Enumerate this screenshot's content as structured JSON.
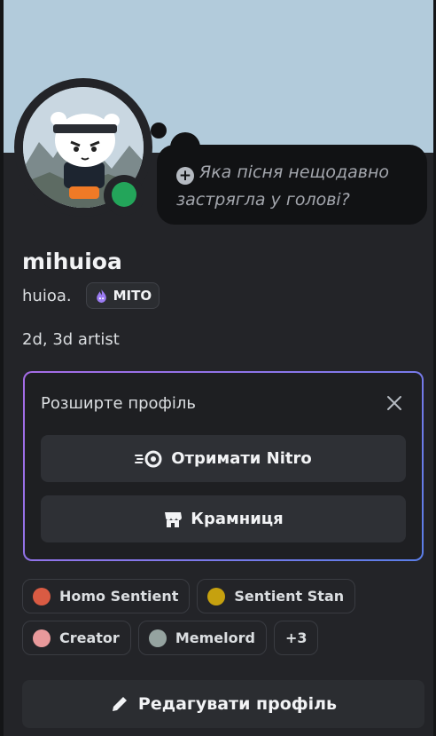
{
  "profile": {
    "display_name": "mihuioa",
    "username": "huioa.",
    "tag": "МІТО",
    "bio": "2d, 3d artist",
    "status_color": "#23a55a",
    "banner_color": "#b2cbdb"
  },
  "status_bubble": {
    "icon": "plus-circle-icon",
    "placeholder": "Яка пісня нещодавно застрягла у голові?"
  },
  "promo": {
    "title": "Розширте профіль",
    "close_icon": "close-icon",
    "nitro_label": "Отримати Nitro",
    "nitro_icon": "nitro-icon",
    "shop_label": "Крамниця",
    "shop_icon": "shop-icon"
  },
  "roles": [
    {
      "label": "Homo Sentient",
      "color": "#d95b43"
    },
    {
      "label": "Sentient Stan",
      "color": "#c6a10f"
    },
    {
      "label": "Creator",
      "color": "#e8999b"
    },
    {
      "label": "Memelord",
      "color": "#95a3a0"
    }
  ],
  "roles_more": "+3",
  "edit_button": {
    "label": "Редагувати профіль",
    "icon": "pencil-icon"
  }
}
